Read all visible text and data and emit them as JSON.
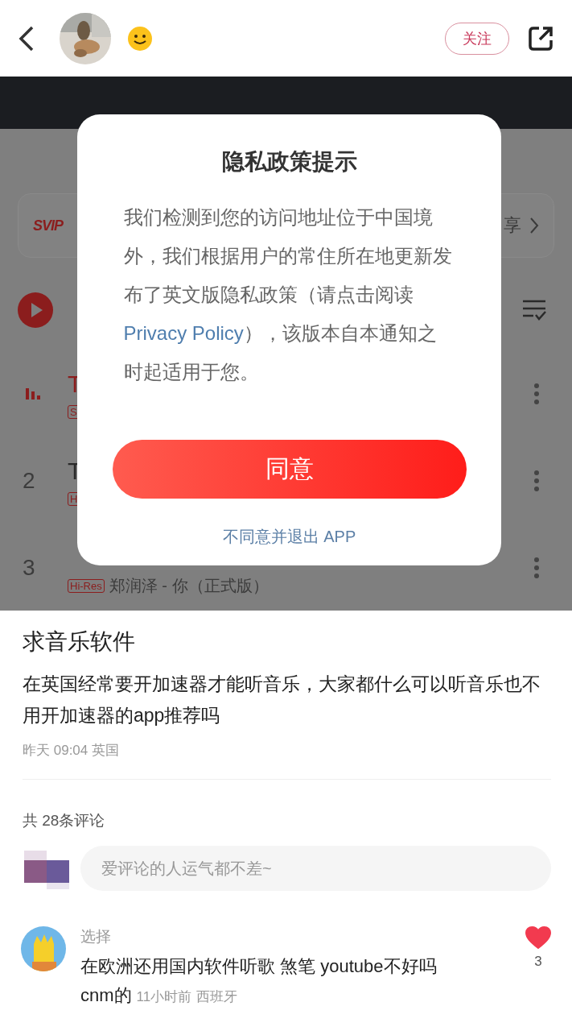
{
  "header": {
    "follow_button": "关注"
  },
  "screenshot": {
    "vip_badge": "SVIP",
    "vip_text": "享",
    "songs": [
      {
        "playing": true,
        "title": "T",
        "tag": "S"
      },
      {
        "playing": false,
        "rank": "2",
        "title": "T",
        "tag": "H"
      },
      {
        "playing": false,
        "rank": "3",
        "tag": "Hi-Res",
        "subtitle": "郑润泽 - 你（正式版）"
      }
    ],
    "dialog": {
      "title": "隐私政策提示",
      "body_before": "我们检测到您的访问地址位于中国境外，我们根据用户的常住所在地更新发布了英文版隐私政策（请点击阅读",
      "link": "Privacy Policy",
      "body_after": "），该版本自本通知之时起适用于您。",
      "agree_button": "同意",
      "decline_link": "不同意并退出 APP"
    }
  },
  "post": {
    "title": "求音乐软件",
    "body": "在英国经常要开加速器才能听音乐，大家都什么可以听音乐也不用开加速器的app推荐吗",
    "meta": "昨天 09:04 英国"
  },
  "comments": {
    "count": "共 28条评论",
    "input_placeholder": "爱评论的人运气都不差~",
    "items": [
      {
        "author": "选择",
        "text": "在欧洲还用国内软件听歌 煞笔 youtube不好吗cnm的",
        "time": "11小时前",
        "location": "西班牙",
        "likes": "3",
        "liked": true
      }
    ]
  }
}
